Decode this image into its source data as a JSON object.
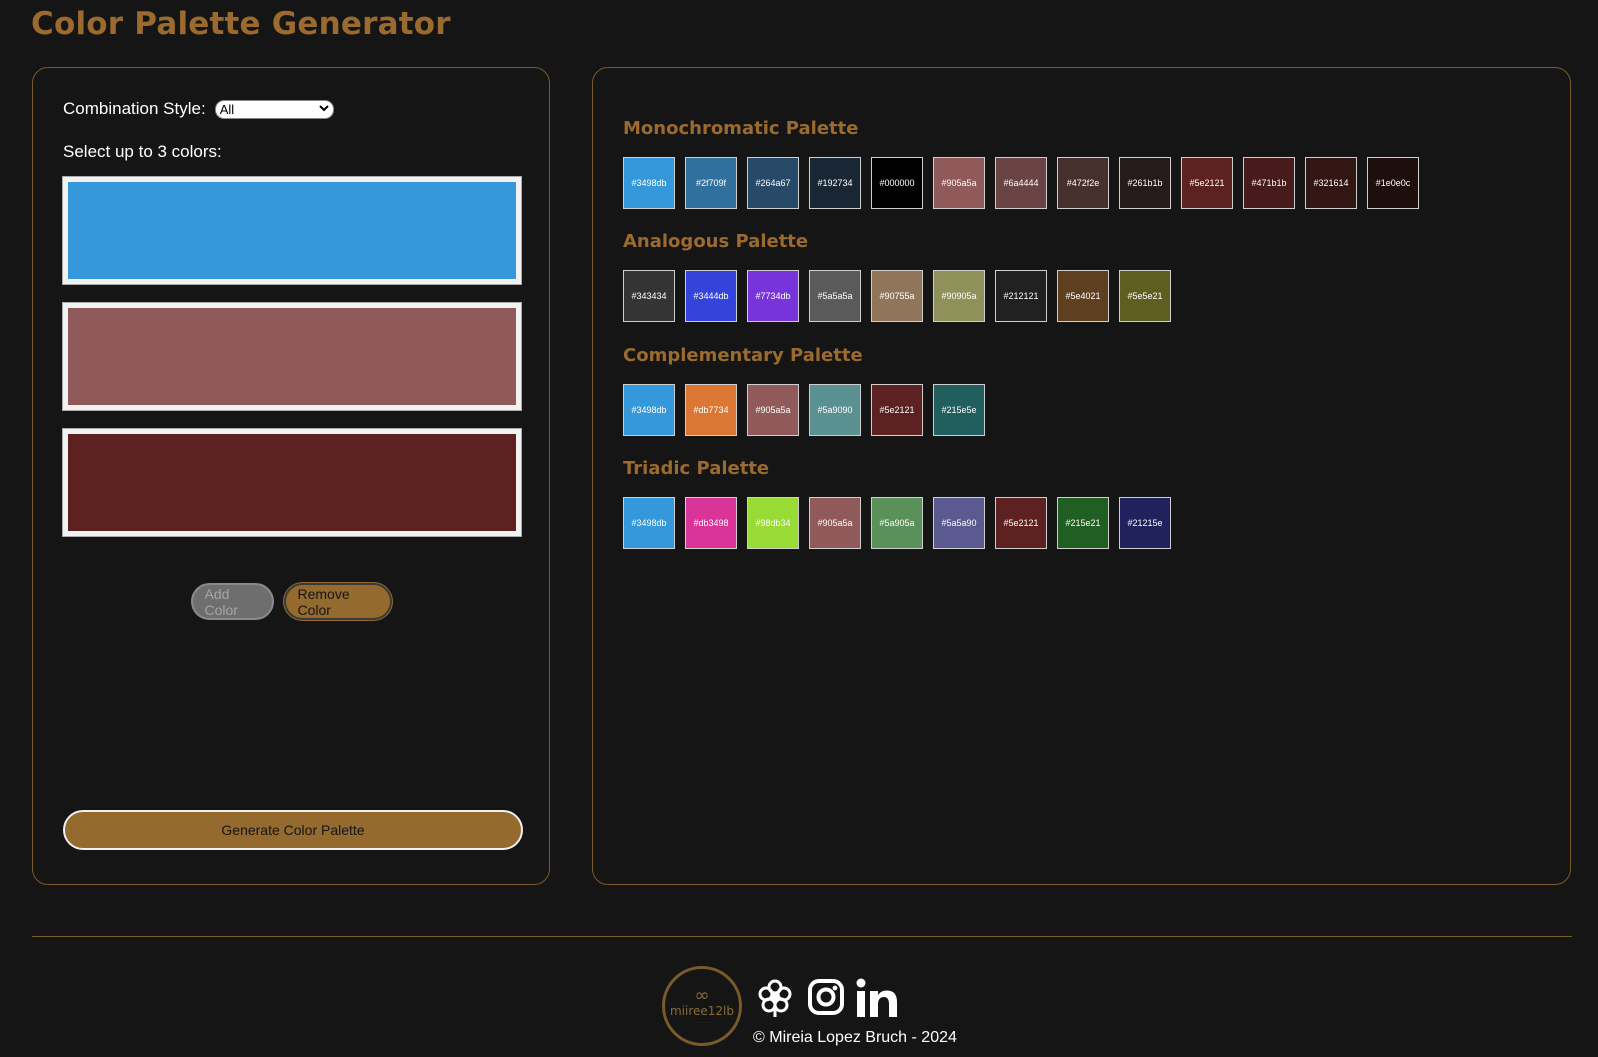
{
  "page_title": "Color Palette Generator",
  "controls": {
    "combination_label": "Combination Style:",
    "combination_value": "All",
    "select_label": "Select up to 3 colors:",
    "selected_colors": [
      "#3498db",
      "#905a5a",
      "#5e2121"
    ],
    "add_button": "Add Color",
    "remove_button": "Remove Color",
    "generate_button": "Generate Color Palette"
  },
  "palettes": [
    {
      "title": "Monochromatic Palette",
      "colors": [
        "#3498db",
        "#2f709f",
        "#264a67",
        "#192734",
        "#000000",
        "#905a5a",
        "#6a4444",
        "#472f2e",
        "#261b1b",
        "#5e2121",
        "#471b1b",
        "#321614",
        "#1e0e0c"
      ]
    },
    {
      "title": "Analogous Palette",
      "colors": [
        "#343434",
        "#3444db",
        "#7734db",
        "#5a5a5a",
        "#90755a",
        "#90905a",
        "#212121",
        "#5e4021",
        "#5e5e21"
      ]
    },
    {
      "title": "Complementary Palette",
      "colors": [
        "#3498db",
        "#db7734",
        "#905a5a",
        "#5a9090",
        "#5e2121",
        "#215e5e"
      ]
    },
    {
      "title": "Triadic Palette",
      "colors": [
        "#3498db",
        "#db3498",
        "#98db34",
        "#905a5a",
        "#5a905a",
        "#5a5a90",
        "#5e2121",
        "#215e21",
        "#21215e"
      ]
    }
  ],
  "footer": {
    "logo_text": "miiree12lb",
    "copyright": "© Mireia Lopez Bruch - 2024"
  },
  "theme": {
    "accent": "#946a2f",
    "background": "#151515"
  }
}
